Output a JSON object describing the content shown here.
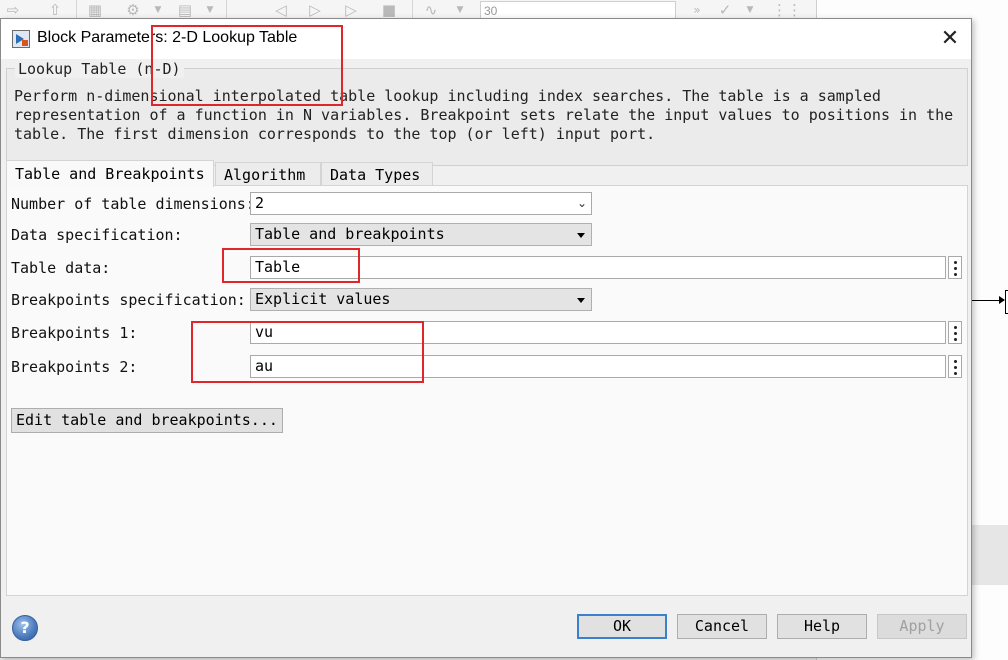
{
  "background": {
    "toolbar": {
      "sim_time": "30",
      "icons": [
        "forward-arrow-icon",
        "up-arrow-icon",
        "model-explorer-icon",
        "gear-icon",
        "chevron-down-icon",
        "library-icon",
        "chevron-down-icon",
        "step-back-icon",
        "run-icon",
        "step-forward-icon",
        "stop-icon",
        "scope-icon",
        "chevron-down-icon",
        "more-icon",
        "check-icon",
        "chevron-down-icon",
        "grid-icon"
      ]
    }
  },
  "dialog": {
    "title": "Block Parameters: 2-D Lookup Table",
    "close_glyph": "✕",
    "group_title": "Lookup Table (n-D)",
    "description": "Perform n-dimensional interpolated table lookup including index searches. The table is a sampled representation of a function in N variables. Breakpoint sets relate the input values to positions in the table. The first dimension corresponds to the top (or left) input port.",
    "tabs": [
      "Table and Breakpoints",
      "Algorithm",
      "Data Types"
    ],
    "fields": {
      "num_dims_label": "Number of table dimensions:",
      "num_dims_value": "2",
      "data_spec_label": "Data specification:",
      "data_spec_value": "Table and breakpoints",
      "table_data_label": "Table data:",
      "table_data_value": "Table",
      "bp_spec_label": "Breakpoints specification:",
      "bp_spec_value": "Explicit values",
      "bp1_label": "Breakpoints 1:",
      "bp1_value": "vu",
      "bp2_label": "Breakpoints 2:",
      "bp2_value": "au"
    },
    "edit_button": "Edit table and breakpoints...",
    "buttons": {
      "ok": "OK",
      "cancel": "Cancel",
      "help": "Help",
      "apply": "Apply"
    },
    "help_glyph": "?"
  },
  "colors": {
    "annotation": "#e0262a",
    "default_button_border": "#3c7fcc"
  }
}
